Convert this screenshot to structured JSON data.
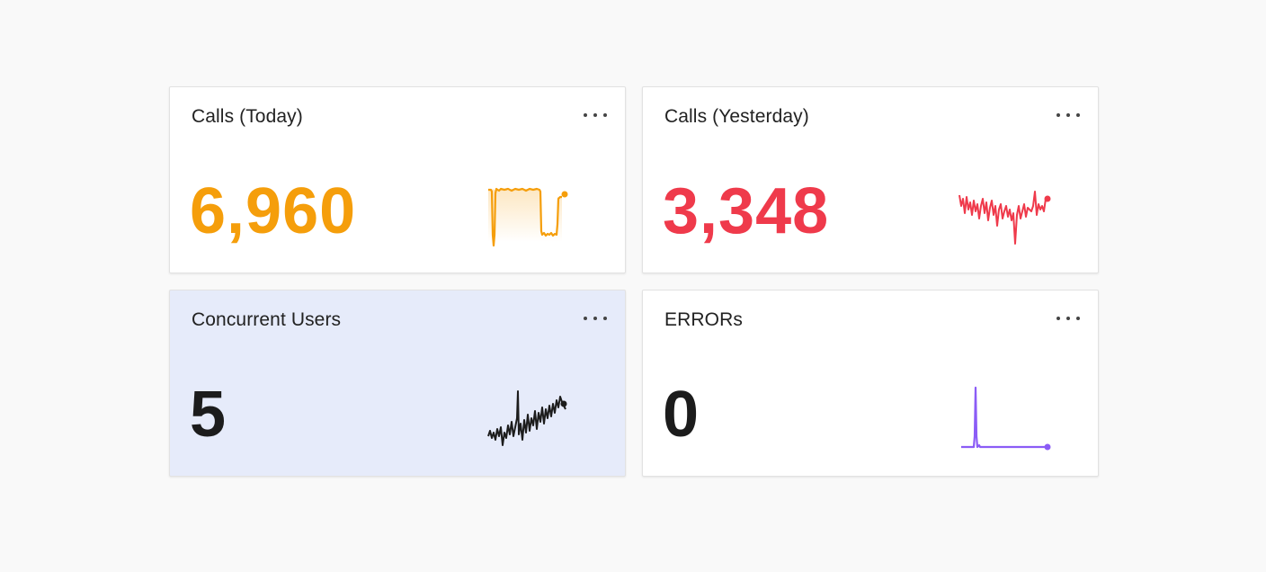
{
  "cards": [
    {
      "title": "Calls (Today)",
      "value": "6,960",
      "color": "#f59e0b",
      "highlighted": false,
      "sparkline_shape": "plateau-then-drop",
      "icon": "more-horizontal-icon"
    },
    {
      "title": "Calls (Yesterday)",
      "value": "3,348",
      "color": "#ef3a4b",
      "highlighted": false,
      "sparkline_shape": "noisy-flat",
      "icon": "more-horizontal-icon"
    },
    {
      "title": "Concurrent Users",
      "value": "5",
      "color": "#1c1c1c",
      "highlighted": true,
      "sparkline_shape": "noisy-rising",
      "icon": "more-horizontal-icon"
    },
    {
      "title": "ERRORs",
      "value": "0",
      "color": "#8b5cf6",
      "value_color": "#1c1c1c",
      "highlighted": false,
      "sparkline_shape": "single-spike",
      "icon": "more-horizontal-icon"
    }
  ]
}
